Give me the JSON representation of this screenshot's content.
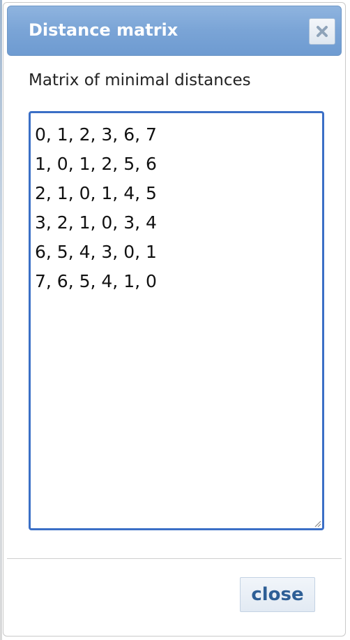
{
  "dialog": {
    "title": "Distance matrix",
    "close_icon": "close-x-icon",
    "prompt": "Matrix of minimal distances",
    "matrix_text": "0, 1, 2, 3, 6, 7\n1, 0, 1, 2, 5, 6\n2, 1, 0, 1, 4, 5\n3, 2, 1, 0, 3, 4\n6, 5, 4, 3, 0, 1\n7, 6, 5, 4, 1, 0\n",
    "matrix_rows": [
      [
        0,
        1,
        2,
        3,
        6,
        7
      ],
      [
        1,
        0,
        1,
        2,
        5,
        6
      ],
      [
        2,
        1,
        0,
        1,
        4,
        5
      ],
      [
        3,
        2,
        1,
        0,
        3,
        4
      ],
      [
        6,
        5,
        4,
        3,
        0,
        1
      ],
      [
        7,
        6,
        5,
        4,
        1,
        0
      ]
    ],
    "close_button_label": "close"
  },
  "colors": {
    "titlebar": "#7aa4d6",
    "textarea_focus_border": "#3b6fc6",
    "close_button_text": "#2e5f96"
  }
}
